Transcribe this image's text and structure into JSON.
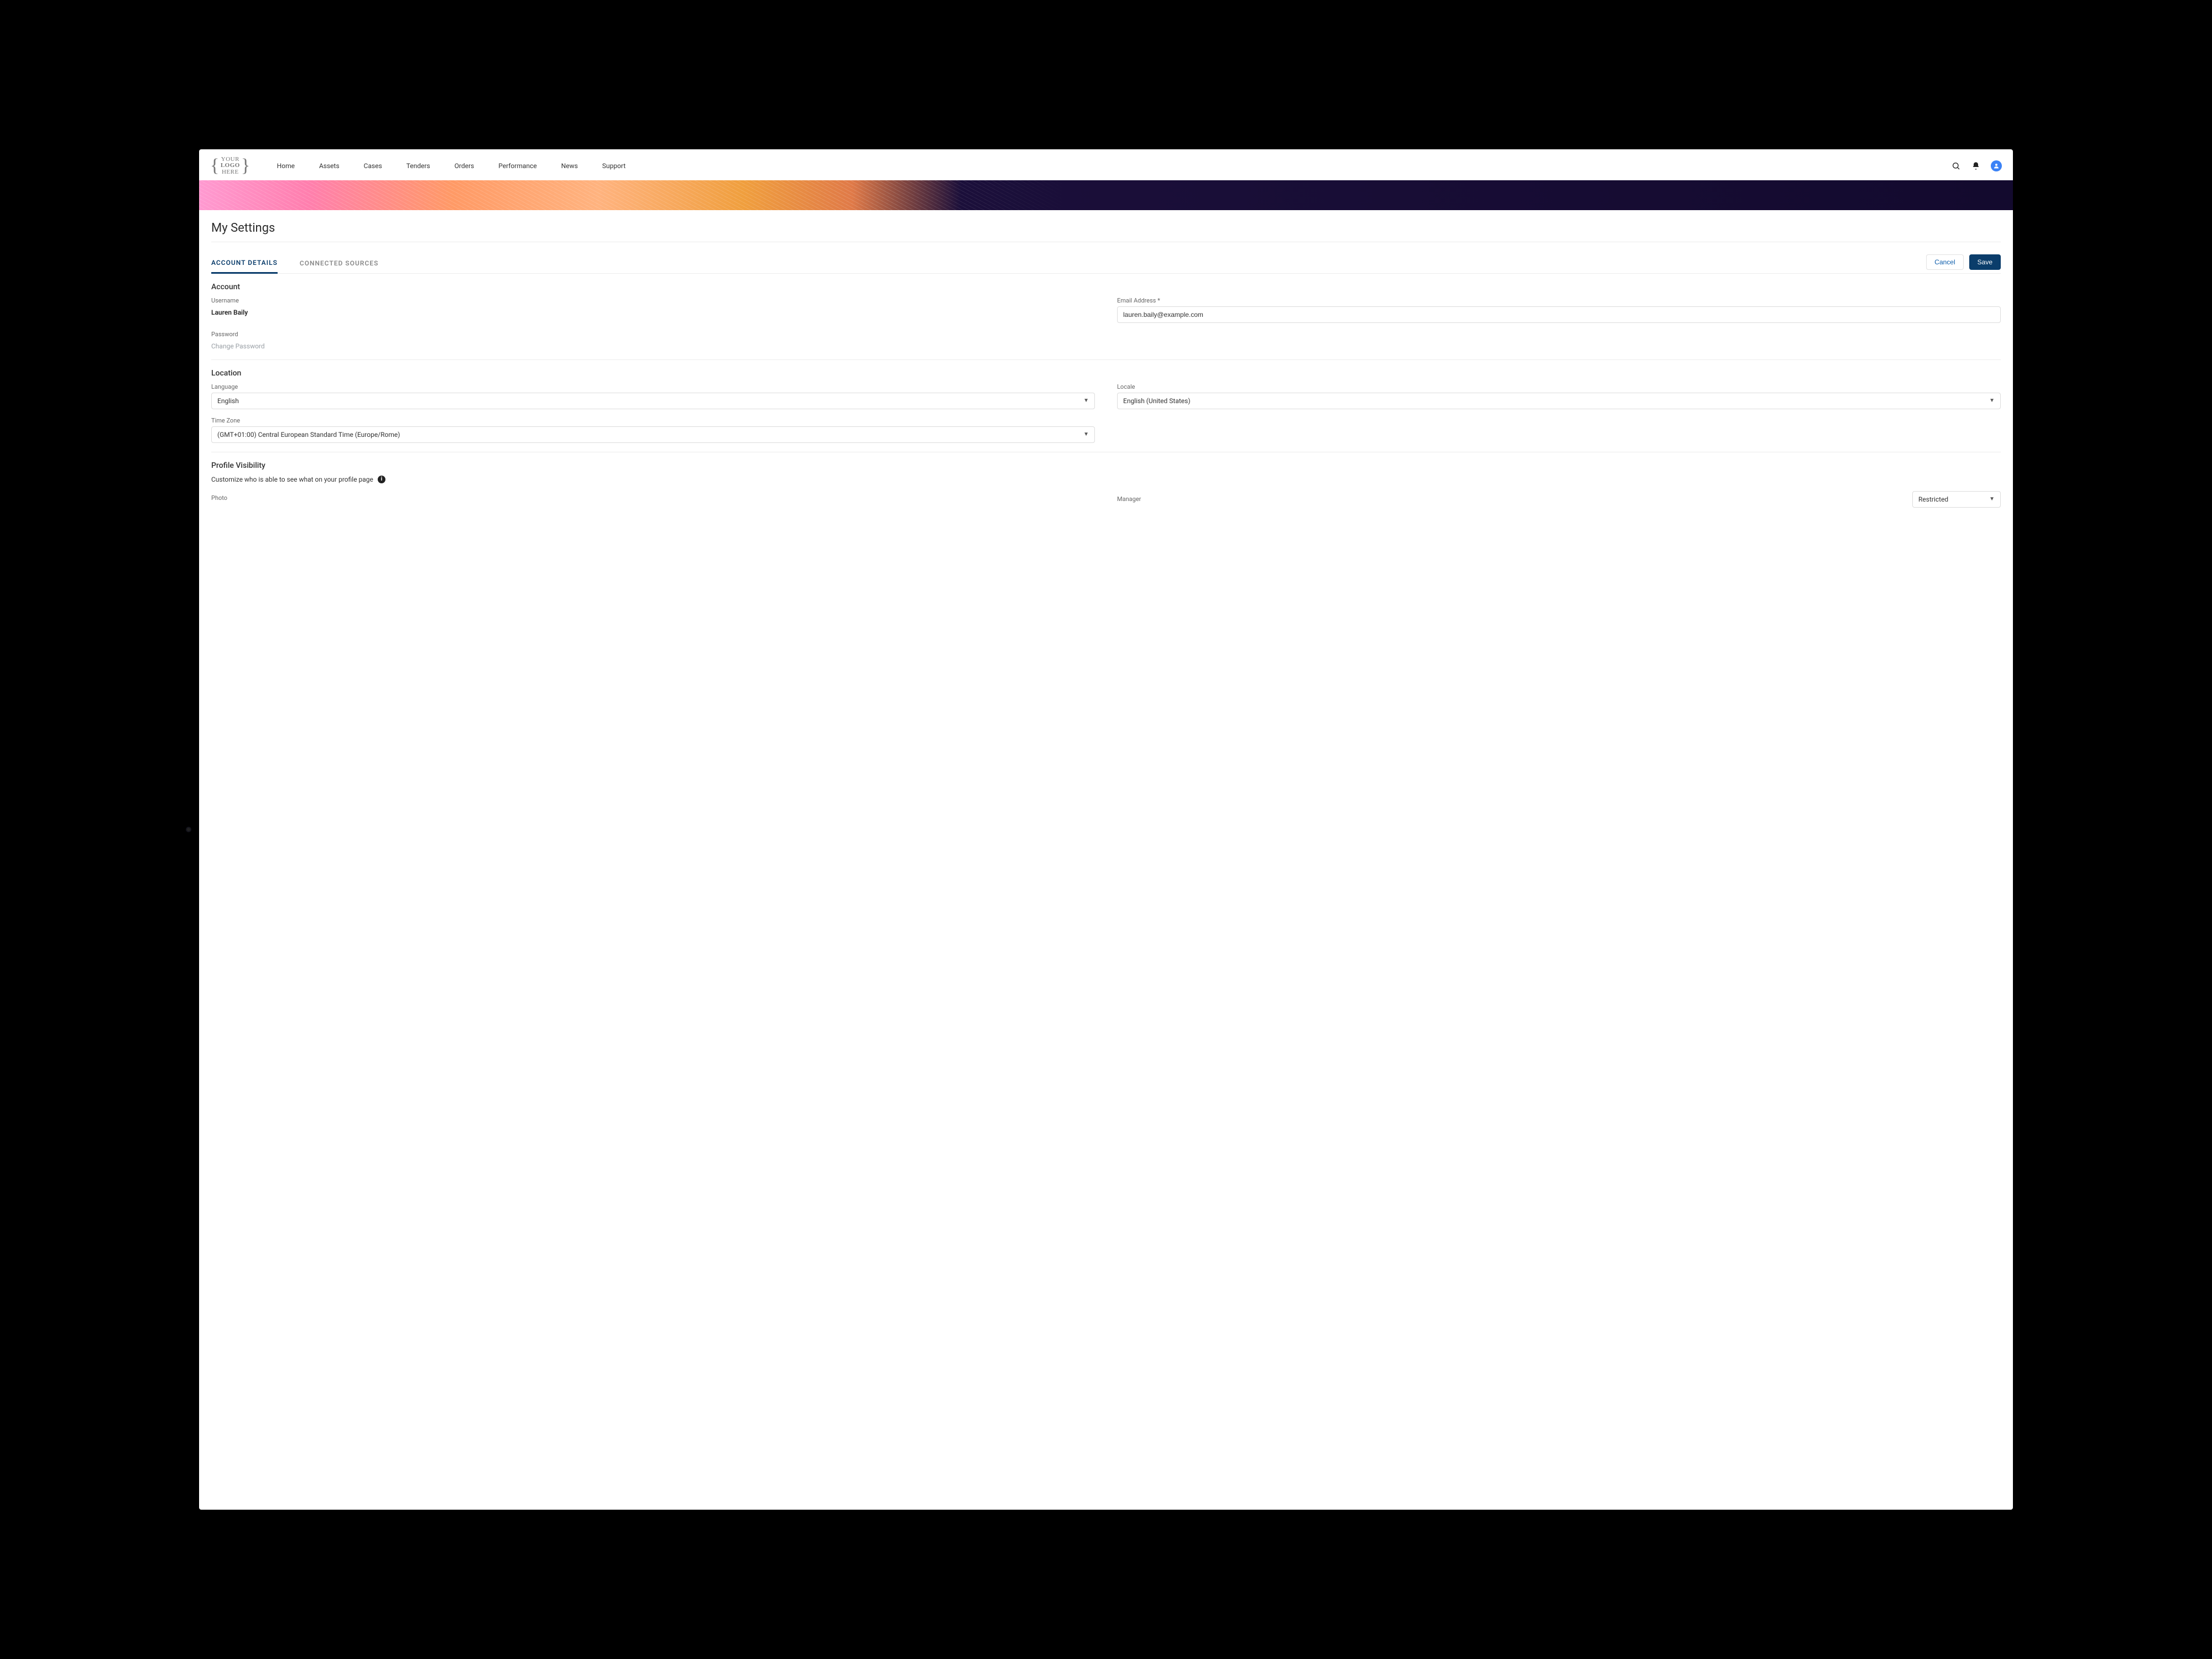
{
  "logo": {
    "line1": "YOUR",
    "line2": "LOGO",
    "line3": "HERE"
  },
  "nav": {
    "home": "Home",
    "assets": "Assets",
    "cases": "Cases",
    "tenders": "Tenders",
    "orders": "Orders",
    "performance": "Performance",
    "news": "News",
    "support": "Support"
  },
  "page": {
    "title": "My Settings"
  },
  "tabs": {
    "account_details": "ACCOUNT DETAILS",
    "connected_sources": "CONNECTED SOURCES"
  },
  "actions": {
    "cancel": "Cancel",
    "save": "Save"
  },
  "sections": {
    "account": "Account",
    "location": "Location",
    "profile_visibility": "Profile Visibility"
  },
  "account": {
    "username_label": "Username",
    "username_value": "Lauren Baily",
    "email_label": "Email Address *",
    "email_value": "lauren.baily@example.com",
    "password_label": "Password",
    "change_password": "Change Password"
  },
  "location": {
    "language_label": "Language",
    "language_value": "English",
    "locale_label": "Locale",
    "locale_value": "English (United States)",
    "timezone_label": "Time Zone",
    "timezone_value": "(GMT+01:00) Central European Standard Time (Europe/Rome)"
  },
  "visibility": {
    "help_text": "Customize who is able to see what on your profile page",
    "photo_label": "Photo",
    "manager_label": "Manager",
    "manager_value": "Restricted"
  }
}
